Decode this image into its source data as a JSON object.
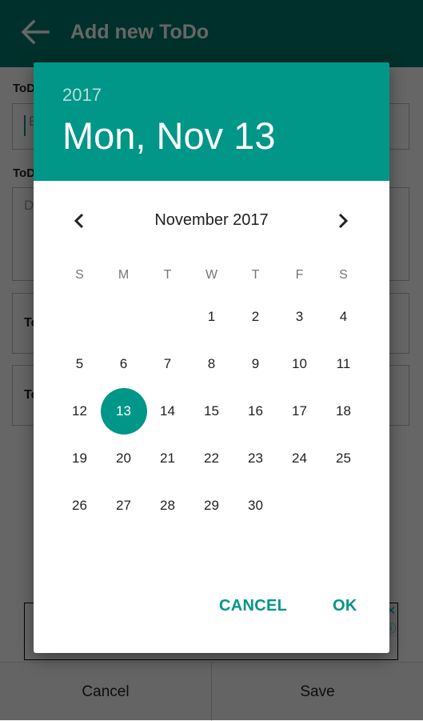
{
  "appbar": {
    "title": "Add new ToDo",
    "back_icon": "arrow-left-icon",
    "color": "#00796b"
  },
  "form": {
    "title_label": "ToD",
    "title_placeholder": "E",
    "desc_label": "ToD",
    "desc_placeholder": "D",
    "field3_text": "To",
    "field4_text": "To"
  },
  "ad": {
    "close_icon": "close-icon",
    "info_icon": "info-icon",
    "close_glyph": "✕",
    "info_glyph": "ⓘ"
  },
  "bottom_bar": {
    "cancel_label": "Cancel",
    "save_label": "Save"
  },
  "date_picker": {
    "accent_color": "#009688",
    "header_year": "2017",
    "header_date": "Mon, Nov 13",
    "month_label": "November 2017",
    "prev_icon": "chevron-left-icon",
    "next_icon": "chevron-right-icon",
    "weekdays": [
      "S",
      "M",
      "T",
      "W",
      "T",
      "F",
      "S"
    ],
    "weeks": [
      [
        "",
        "",
        "",
        "1",
        "2",
        "3",
        "4"
      ],
      [
        "5",
        "6",
        "7",
        "8",
        "9",
        "10",
        "11"
      ],
      [
        "12",
        "13",
        "14",
        "15",
        "16",
        "17",
        "18"
      ],
      [
        "19",
        "20",
        "21",
        "22",
        "23",
        "24",
        "25"
      ],
      [
        "26",
        "27",
        "28",
        "29",
        "30",
        "",
        ""
      ]
    ],
    "selected_day": "13",
    "cancel_label": "CANCEL",
    "ok_label": "OK"
  }
}
